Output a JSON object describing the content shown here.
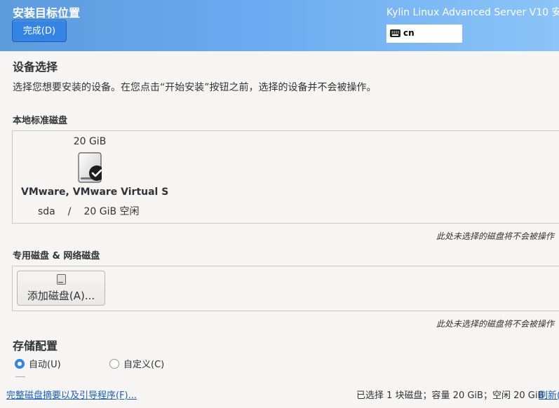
{
  "header": {
    "title": "安装目标位置",
    "done_label": "完成(D)",
    "product": "Kylin Linux Advanced Server V10 安",
    "keyboard_layout": "cn"
  },
  "device_selection": {
    "title": "设备选择",
    "description": "选择您想要安装的设备。在您点击“开始安装”按钮之前，选择的设备并不会被操作。"
  },
  "local_disks": {
    "title": "本地标准磁盘",
    "disks": [
      {
        "size": "20 GiB",
        "name": "VMware, VMware Virtual S",
        "device": "sda",
        "separator": "/",
        "free": "20 GiB 空闲",
        "selected": true
      }
    ],
    "note": "此处未选择的磁盘将不会被操作"
  },
  "special_disks": {
    "title": "专用磁盘 & 网络磁盘",
    "add_disk_label": "添加磁盘(A)...",
    "note": "此处未选择的磁盘将不会被操作"
  },
  "storage_config": {
    "title": "存储配置",
    "options": [
      {
        "label": "自动(U)",
        "checked": true
      },
      {
        "label": "自定义(C)",
        "checked": false
      }
    ]
  },
  "footer": {
    "summary_link": "完整磁盘摘要以及引导程序(F)...",
    "status": "已选择 1 块磁盘；容量 20 GiB；空闲 20 GiB",
    "refresh_label": "刷新("
  },
  "colors": {
    "accent": "#3584e4",
    "link": "#1a5fb4",
    "header_gradient_start": "#5c9bdc",
    "header_gradient_end": "#8cc4f7"
  }
}
